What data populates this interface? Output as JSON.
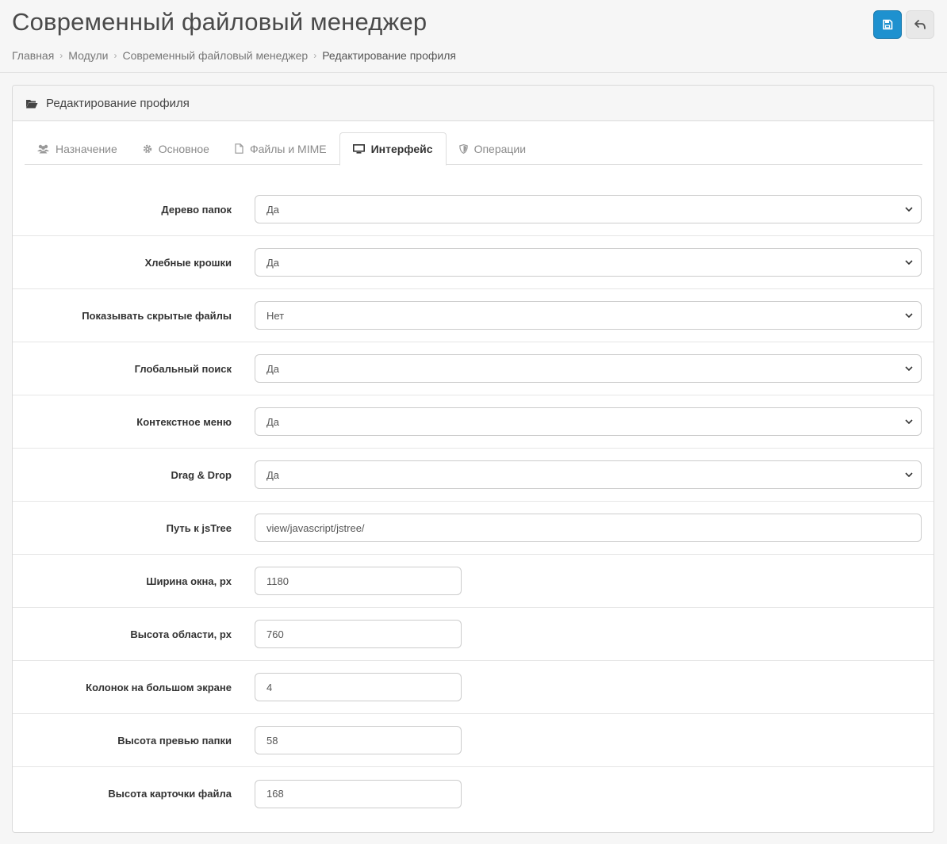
{
  "page": {
    "title": "Современный файловый менеджер",
    "breadcrumb": [
      "Главная",
      "Модули",
      "Современный файловый менеджер",
      "Редактирование профиля"
    ]
  },
  "header_buttons": {
    "save_icon": "floppy-disk-icon",
    "back_icon": "reply-arrow-icon",
    "save_color": "#1e91cf"
  },
  "card": {
    "title": "Редактирование профиля",
    "icon": "folder-open-icon"
  },
  "tabs": [
    {
      "label": "Назначение",
      "icon": "users-icon",
      "active": false
    },
    {
      "label": "Основное",
      "icon": "gear-icon",
      "active": false
    },
    {
      "label": "Файлы и MIME",
      "icon": "file-icon",
      "active": false
    },
    {
      "label": "Интерфейс",
      "icon": "monitor-icon",
      "active": true
    },
    {
      "label": "Операции",
      "icon": "shield-icon",
      "active": false
    }
  ],
  "fields": [
    {
      "label": "Дерево папок",
      "type": "select",
      "value": "Да"
    },
    {
      "label": "Хлебные крошки",
      "type": "select",
      "value": "Да"
    },
    {
      "label": "Показывать скрытые файлы",
      "type": "select",
      "value": "Нет"
    },
    {
      "label": "Глобальный поиск",
      "type": "select",
      "value": "Да"
    },
    {
      "label": "Контекстное меню",
      "type": "select",
      "value": "Да"
    },
    {
      "label": "Drag & Drop",
      "type": "select",
      "value": "Да"
    },
    {
      "label": "Путь к jsTree",
      "type": "text",
      "value": "view/javascript/jstree/"
    },
    {
      "label": "Ширина окна, px",
      "type": "number",
      "value": "1180"
    },
    {
      "label": "Высота области, px",
      "type": "number",
      "value": "760"
    },
    {
      "label": "Колонок на большом экране",
      "type": "number",
      "value": "4"
    },
    {
      "label": "Высота превью папки",
      "type": "number",
      "value": "58"
    },
    {
      "label": "Высота карточки файла",
      "type": "number",
      "value": "168"
    }
  ]
}
